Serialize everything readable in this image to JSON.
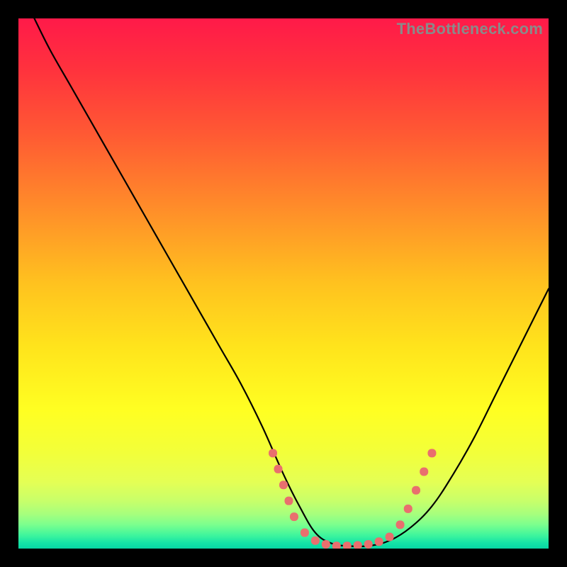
{
  "watermark": "TheBottleneck.com",
  "colors": {
    "frame": "#000000",
    "curve": "#000000",
    "dots": "#e96f6e",
    "gradient_stops": [
      {
        "offset": 0.0,
        "color": "#ff1a49"
      },
      {
        "offset": 0.1,
        "color": "#ff333d"
      },
      {
        "offset": 0.22,
        "color": "#ff5a33"
      },
      {
        "offset": 0.35,
        "color": "#ff8a2a"
      },
      {
        "offset": 0.5,
        "color": "#ffc21f"
      },
      {
        "offset": 0.62,
        "color": "#ffe41c"
      },
      {
        "offset": 0.74,
        "color": "#ffff22"
      },
      {
        "offset": 0.82,
        "color": "#f2ff3a"
      },
      {
        "offset": 0.875,
        "color": "#e4ff55"
      },
      {
        "offset": 0.91,
        "color": "#c8ff6a"
      },
      {
        "offset": 0.935,
        "color": "#a6ff7d"
      },
      {
        "offset": 0.955,
        "color": "#7bff8e"
      },
      {
        "offset": 0.975,
        "color": "#3ef59d"
      },
      {
        "offset": 0.99,
        "color": "#13e3a6"
      },
      {
        "offset": 1.0,
        "color": "#08d6a4"
      }
    ]
  },
  "chart_data": {
    "type": "line",
    "title": "",
    "xlabel": "",
    "ylabel": "",
    "xlim": [
      0,
      100
    ],
    "ylim": [
      0,
      100
    ],
    "series": [
      {
        "name": "bottleneck-curve",
        "x": [
          3,
          6,
          10,
          14,
          18,
          22,
          26,
          30,
          34,
          38,
          42,
          46,
          50,
          53,
          56,
          59,
          62,
          66,
          70,
          74,
          78,
          82,
          86,
          90,
          94,
          98,
          100
        ],
        "y": [
          100,
          94,
          87,
          80,
          73,
          66,
          59,
          52,
          45,
          38,
          31,
          23,
          14,
          8,
          3,
          1,
          0.5,
          0.5,
          1.5,
          4,
          8,
          14,
          21,
          29,
          37,
          45,
          49
        ]
      }
    ],
    "highlight_dots": {
      "name": "sweet-spot",
      "points": [
        {
          "x": 48,
          "y": 18
        },
        {
          "x": 49,
          "y": 15
        },
        {
          "x": 50,
          "y": 12
        },
        {
          "x": 51,
          "y": 9
        },
        {
          "x": 52,
          "y": 6
        },
        {
          "x": 54,
          "y": 3
        },
        {
          "x": 56,
          "y": 1.5
        },
        {
          "x": 58,
          "y": 0.8
        },
        {
          "x": 60,
          "y": 0.5
        },
        {
          "x": 62,
          "y": 0.5
        },
        {
          "x": 64,
          "y": 0.6
        },
        {
          "x": 66,
          "y": 0.8
        },
        {
          "x": 68,
          "y": 1.3
        },
        {
          "x": 70,
          "y": 2.2
        },
        {
          "x": 72,
          "y": 4.5
        },
        {
          "x": 73.5,
          "y": 7.5
        },
        {
          "x": 75,
          "y": 11
        },
        {
          "x": 76.5,
          "y": 14.5
        },
        {
          "x": 78,
          "y": 18
        }
      ]
    }
  }
}
